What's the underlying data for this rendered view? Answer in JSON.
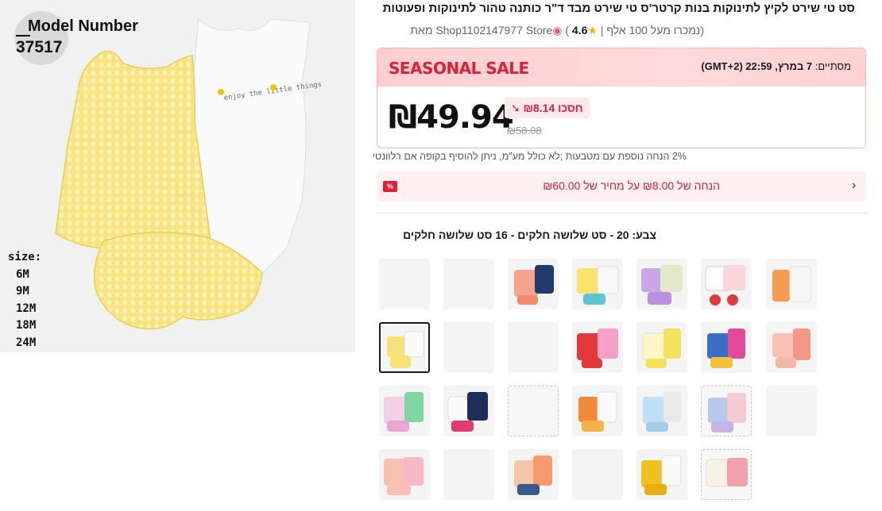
{
  "product": {
    "title": "סט טי שירט לקיץ לתינוקות בנות קרטר'ס טי שירט מבד ד\"ר כותנה טהור לתינוקות ופעוטות",
    "store_line": "(נמכרו מעל 100 אלף | ★4.6 ) Shop1102147977 Store מאת",
    "sold_text": "(נמכרו מעל 100 אלף |",
    "rating": "4.6",
    "store_name": "Shop1102147977 Store",
    "by_label": "מאת"
  },
  "hero_image": {
    "model_title": "Model Number",
    "model_number": "37517",
    "size_label": "size:",
    "sizes": [
      "6M",
      "9M",
      "12M",
      "18M",
      "24M"
    ],
    "bodysuit_text": "enjoy the little things"
  },
  "sale": {
    "label": "SEASONAL SALE",
    "ends_prefix": "מסתיים:",
    "ends_time": "7 במרץ, 22:59 (GMT+2)",
    "price": "₪49.94",
    "save_text": "חסכו ₪8.14",
    "original_price": "₪58.08"
  },
  "coin_note": "2% הנחה נוספת עם מטבעות ;לא כולל מע\"מ, ניתן להוסיף בקופה אם רלוונטי",
  "promo": {
    "text": "הנחה של ₪8.00 על מחיר של ₪60.00",
    "tag": "%"
  },
  "color_label": "צבע: 20 - סט שלושה חלקים - 16 סט שלושה חלקים",
  "swatches": {
    "count": 23,
    "selected_index": 6
  },
  "colors": {
    "accent_red": "#e21f34",
    "sale_bg": "#ffd4d5",
    "promo_bg": "#fff0f1",
    "gingham_yellow": "#f7e27a"
  }
}
